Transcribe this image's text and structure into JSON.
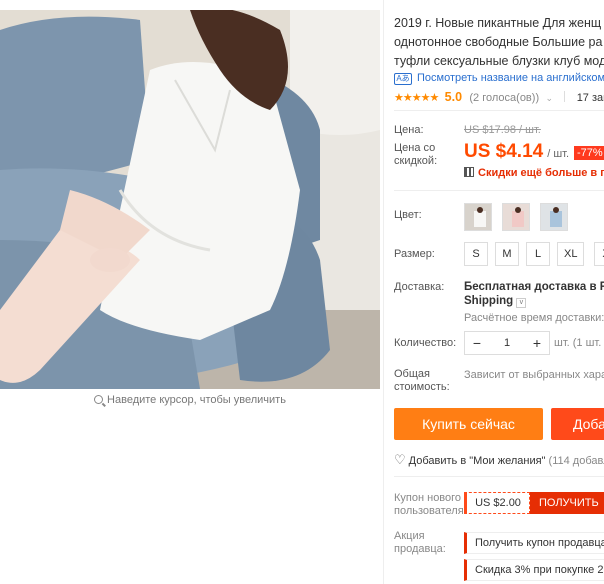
{
  "product": {
    "title_lines": [
      "2019 г. Новые пикантные Для женщ",
      "однотонное свободные Большие ра",
      "туфли сексуальные блузки клуб мод"
    ],
    "translate_link": "Посмотреть название на английском",
    "translate_badge": "Aあ",
    "rating": {
      "stars": "★★★★★",
      "score": "5.0",
      "votes": "(2 голоса(ов))",
      "orders": "17 заказ"
    }
  },
  "gallery": {
    "zoom_hint": "Наведите курсор, чтобы увеличить"
  },
  "price": {
    "label": "Цена:",
    "old": "US $17.98 / шт.",
    "discount_label": "Цена со скидкой:",
    "new": "US $4.14",
    "unit": "/ шт.",
    "discount": "-77%",
    "coupon_link": "Скидки ещё больше в при"
  },
  "options": {
    "color_label": "Цвет:",
    "size_label": "Размер:",
    "sizes": [
      "S",
      "M",
      "L",
      "XL",
      "X"
    ]
  },
  "shipping": {
    "label": "Доставка:",
    "main_line1": "Бесплатная доставка в Russ",
    "main_line2": "Shipping",
    "chevron": "v",
    "time": "Расчётное время доставки: 1"
  },
  "quantity": {
    "label": "Количество:",
    "value": "1",
    "minus": "−",
    "plus": "+",
    "note": "шт. (1 шт. "
  },
  "total": {
    "label": "Общая стоимость:",
    "note": "Зависит от выбранных харак"
  },
  "actions": {
    "buy": "Купить сейчас",
    "cart": "Доба",
    "wish": "Добавить в \"Мои желания\"",
    "wish_count": "(114 добавл"
  },
  "coupons": {
    "store_label": "Купон нового пользователя",
    "store_amount": "US $2.00",
    "get": "ПОЛУЧИТЬ",
    "promo_label": "Акция продавца:",
    "promo_1": "Получить купон продавца",
    "promo_2": "Скидка 3% при покупке 2 ш"
  },
  "colors": {
    "price_accent": "#ff4a00",
    "buy_button": "#ff7e14",
    "cart_button": "#ff4a1a",
    "discount_badge": "#ff3a1e",
    "link": "#2a6fcf",
    "star": "#ff8a00"
  }
}
